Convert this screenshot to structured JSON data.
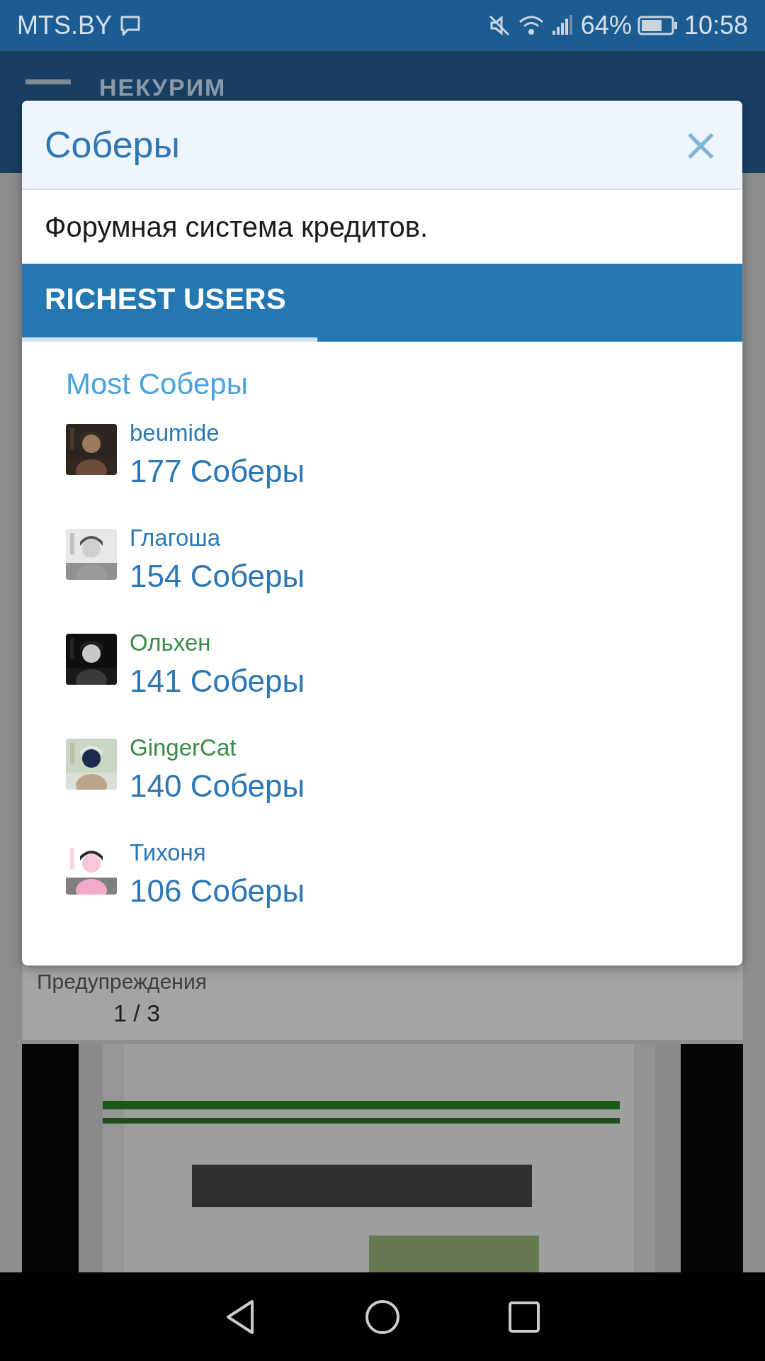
{
  "status_bar": {
    "carrier": "MTS.BY",
    "battery": "64%",
    "time": "10:58"
  },
  "header": {
    "logo": "НЕКУРИМ"
  },
  "background": {
    "label": "Предупреждения",
    "counter": "1 / 3"
  },
  "dialog": {
    "title": "Соберы",
    "close": "×",
    "description": "Форумная система кредитов.",
    "tabs": [
      {
        "label": "RICHEST USERS",
        "selected": true
      }
    ],
    "section_title": "Most Соберы",
    "users": [
      {
        "name": "beumide",
        "amount": "177 Соберы",
        "color": "#2c77b4"
      },
      {
        "name": "Глагоша",
        "amount": "154 Соберы",
        "color": "#2c77b4"
      },
      {
        "name": "Ольхен",
        "amount": "141 Соберы",
        "color": "#3a8a48"
      },
      {
        "name": "GingerCat",
        "amount": "140 Соберы",
        "color": "#3a8a48"
      },
      {
        "name": "Тихоня",
        "amount": "106 Соберы",
        "color": "#2c77b4"
      }
    ]
  }
}
